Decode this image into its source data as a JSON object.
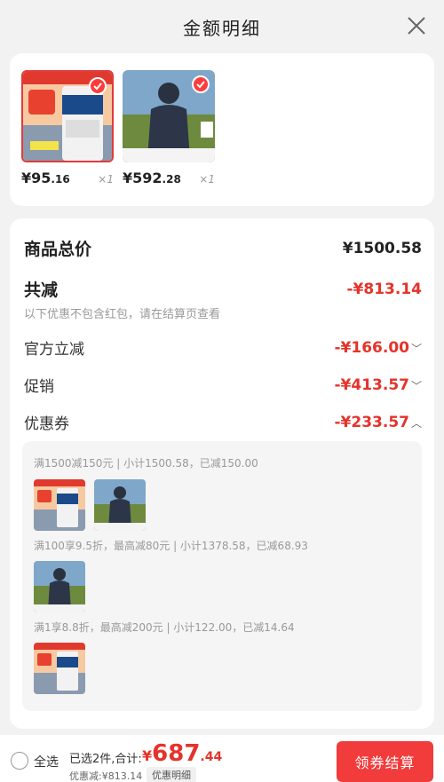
{
  "header": {
    "title": "金额明细"
  },
  "products": [
    {
      "price_int": "¥95",
      "price_dec": ".16",
      "qty": "×1"
    },
    {
      "price_int": "¥592",
      "price_dec": ".28",
      "qty": "×1"
    }
  ],
  "summary": {
    "total_label": "商品总价",
    "total_value": "¥1500.58",
    "reduce_label": "共减",
    "reduce_value": "-¥813.14",
    "note": "以下优惠不包含红包，请在结算页查看",
    "items": [
      {
        "label": "官方立减",
        "value": "-¥166.00",
        "chevron": "﹀"
      },
      {
        "label": "促销",
        "value": "-¥413.57",
        "chevron": "﹀"
      },
      {
        "label": "优惠券",
        "value": "-¥233.57",
        "chevron": "︿"
      }
    ]
  },
  "coupons": [
    {
      "text": "满1500减150元 | 小计1500.58，已减150.00"
    },
    {
      "text": "满100享9.5折，最高减80元 | 小计1378.58，已减68.93"
    },
    {
      "text": "满1享8.8折，最高减200元 | 小计122.00，已减14.64"
    }
  ],
  "footer": {
    "select_all": "全选",
    "selected": "已选2件,合计:",
    "total_sym": "¥",
    "total_int": "687",
    "total_dec": ".44",
    "saved": "优惠减:¥813.14",
    "detail_link": "优惠明细",
    "checkout": "领券结算"
  },
  "colors": {
    "accent": "#e5332a",
    "button": "#f23b3b"
  }
}
